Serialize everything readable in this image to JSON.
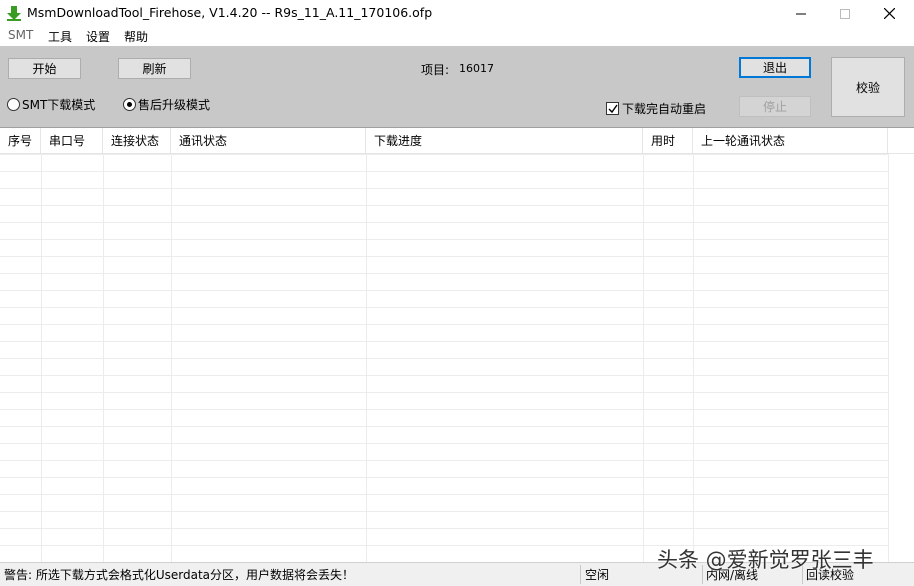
{
  "window": {
    "title": "MsmDownloadTool_Firehose, V1.4.20 -- R9s_11_A.11_170106.ofp"
  },
  "menu": {
    "items": [
      "SMT",
      "工具",
      "设置",
      "帮助"
    ]
  },
  "toolbar": {
    "start_label": "开始",
    "refresh_label": "刷新",
    "project_label": "项目:",
    "project_value": "16017",
    "exit_label": "退出",
    "stop_label": "停止",
    "verify_label": "校验",
    "radio_smt_label": "SMT下载模式",
    "radio_after_label": "售后升级模式",
    "auto_restart_label": "下载完自动重启"
  },
  "table": {
    "columns": [
      "序号",
      "串口号",
      "连接状态",
      "通讯状态",
      "下载进度",
      "用时",
      "上一轮通讯状态"
    ],
    "rows": []
  },
  "status": {
    "warning": "警告: 所选下载方式会格式化Userdata分区，用户数据将会丢失！",
    "idle": "空闲",
    "network": "内网/离线",
    "readback": "回读校验"
  },
  "watermark": "头条 @爱新觉罗张三丰",
  "colors": {
    "toolbar_bg": "#c8c8c8",
    "focus_border": "#0078d7",
    "icon_green": "#3a9d23"
  }
}
